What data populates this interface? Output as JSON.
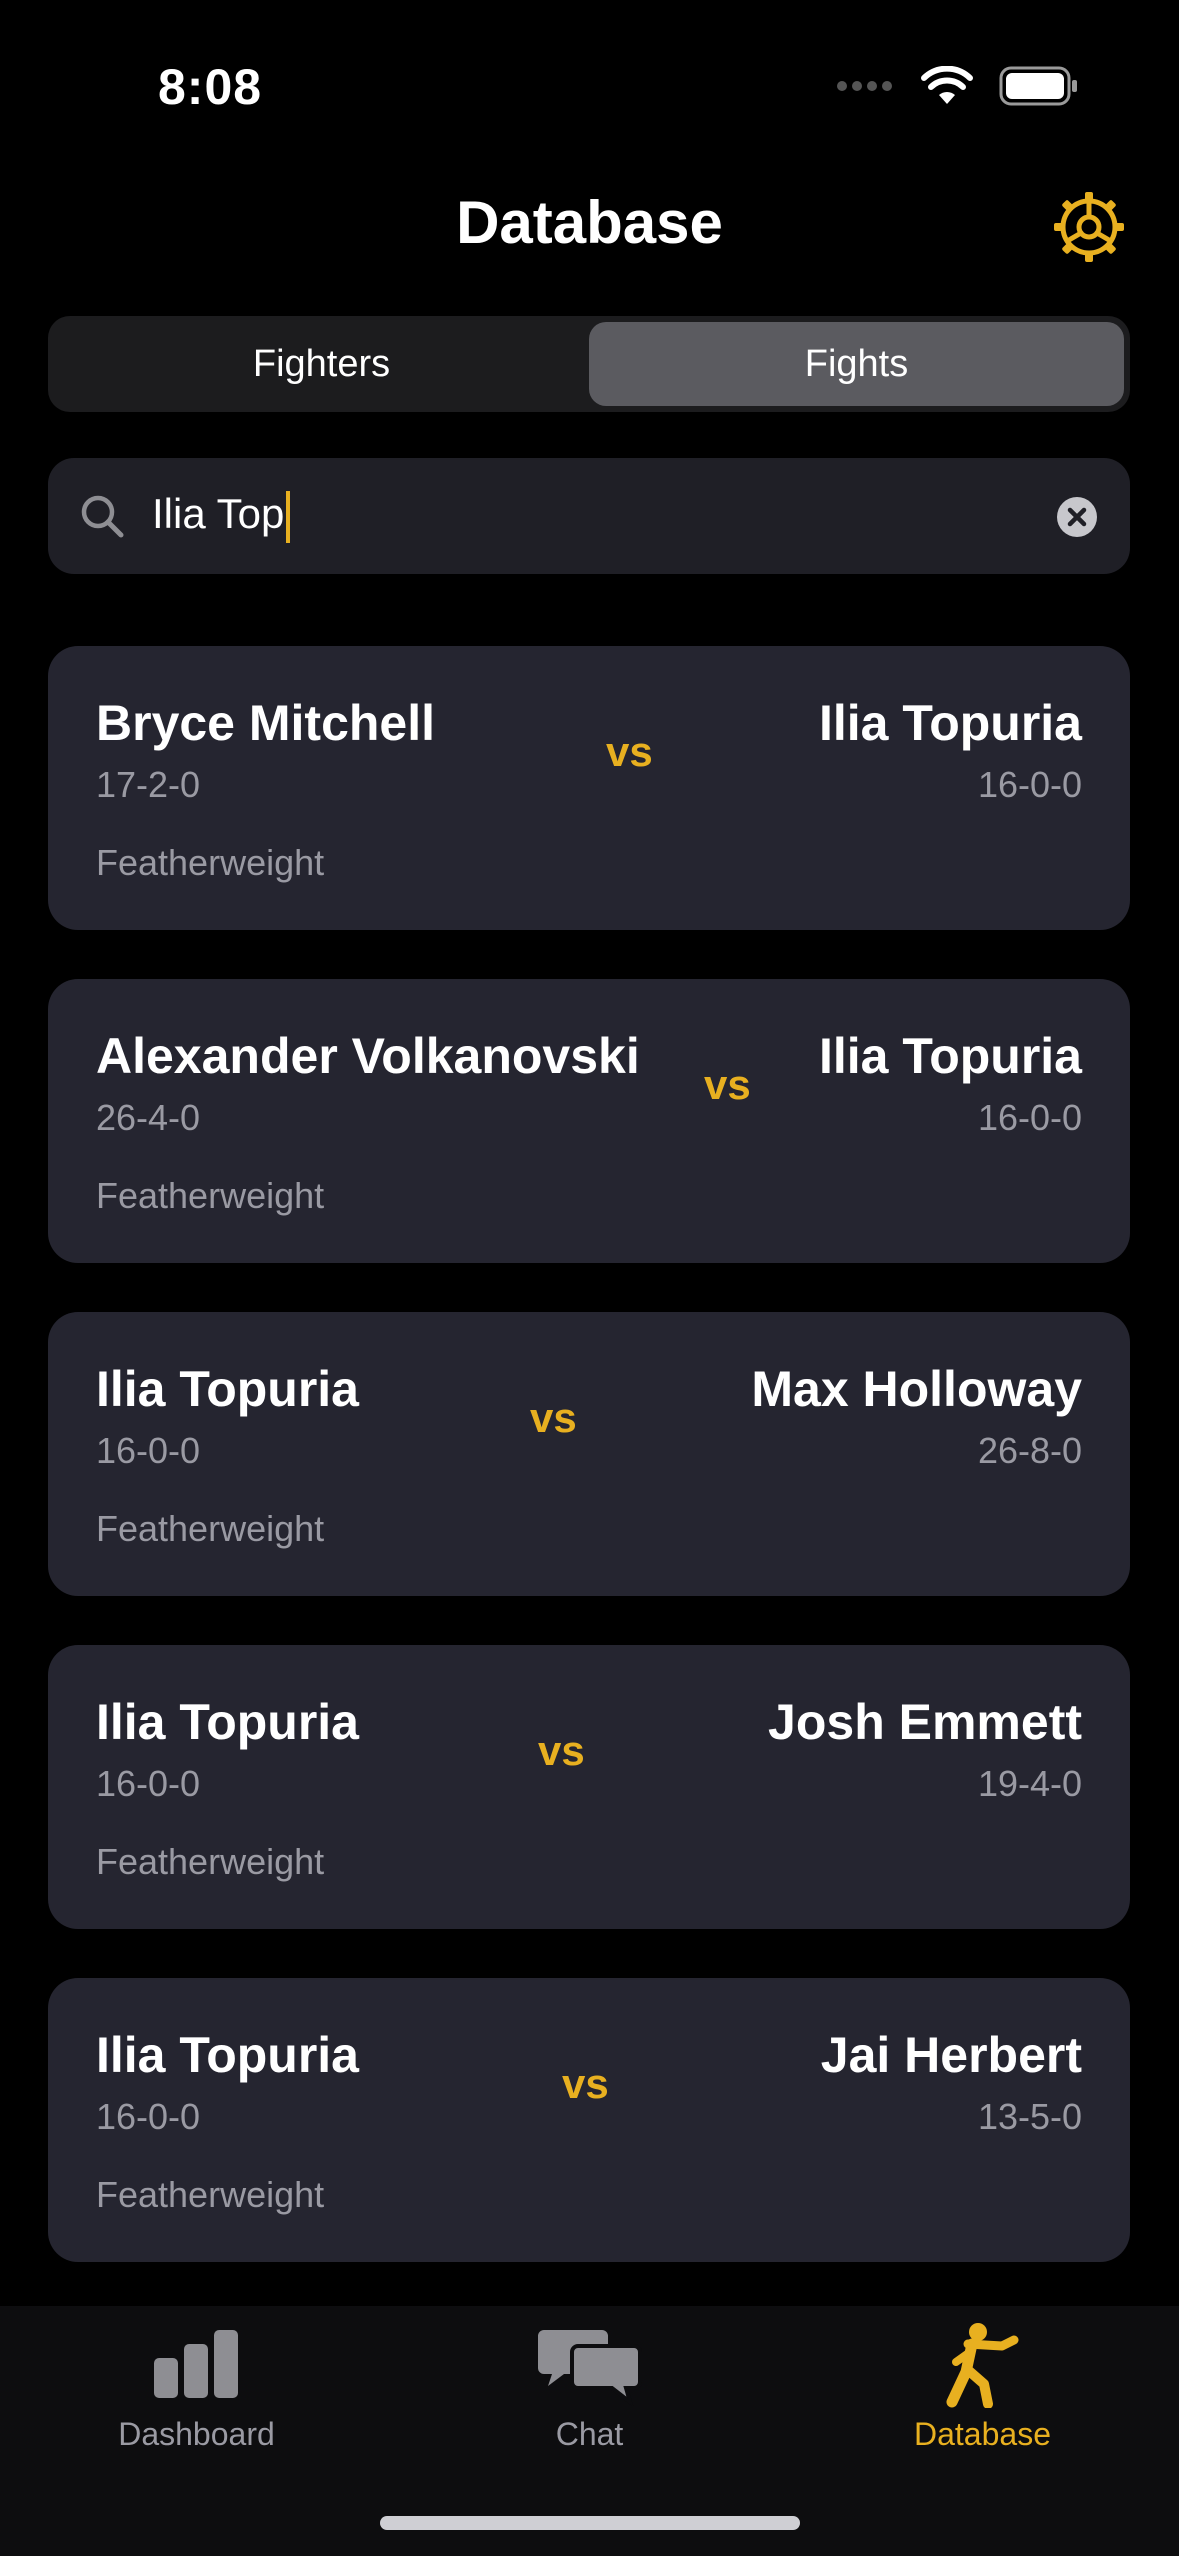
{
  "status": {
    "time": "8:08"
  },
  "header": {
    "title": "Database"
  },
  "segments": [
    {
      "label": "Fighters",
      "active": false
    },
    {
      "label": "Fights",
      "active": true
    }
  ],
  "search": {
    "value": "Ilia Top"
  },
  "fights": [
    {
      "left": {
        "name": "Bryce Mitchell",
        "record": "17-2-0"
      },
      "vs": "vs",
      "right": {
        "name": "Ilia Topuria",
        "record": "16-0-0"
      },
      "weightclass": "Featherweight"
    },
    {
      "left": {
        "name": "Alexander Volkanovski",
        "record": "26-4-0"
      },
      "vs": "vs",
      "right": {
        "name": "Ilia Topuria",
        "record": "16-0-0"
      },
      "weightclass": "Featherweight"
    },
    {
      "left": {
        "name": "Ilia Topuria",
        "record": "16-0-0"
      },
      "vs": "vs",
      "right": {
        "name": "Max Holloway",
        "record": "26-8-0"
      },
      "weightclass": "Featherweight"
    },
    {
      "left": {
        "name": "Ilia Topuria",
        "record": "16-0-0"
      },
      "vs": "vs",
      "right": {
        "name": "Josh Emmett",
        "record": "19-4-0"
      },
      "weightclass": "Featherweight"
    },
    {
      "left": {
        "name": "Ilia Topuria",
        "record": "16-0-0"
      },
      "vs": "vs",
      "right": {
        "name": "Jai Herbert",
        "record": "13-5-0"
      },
      "weightclass": "Featherweight"
    }
  ],
  "tabbar": [
    {
      "label": "Dashboard",
      "icon": "bar-chart-icon",
      "active": false
    },
    {
      "label": "Chat",
      "icon": "chat-bubbles-icon",
      "active": false
    },
    {
      "label": "Database",
      "icon": "fighter-icon",
      "active": true
    }
  ],
  "colors": {
    "accent": "#e8b020",
    "card": "#252530",
    "background": "#000000",
    "muted": "#9a9aa3"
  }
}
